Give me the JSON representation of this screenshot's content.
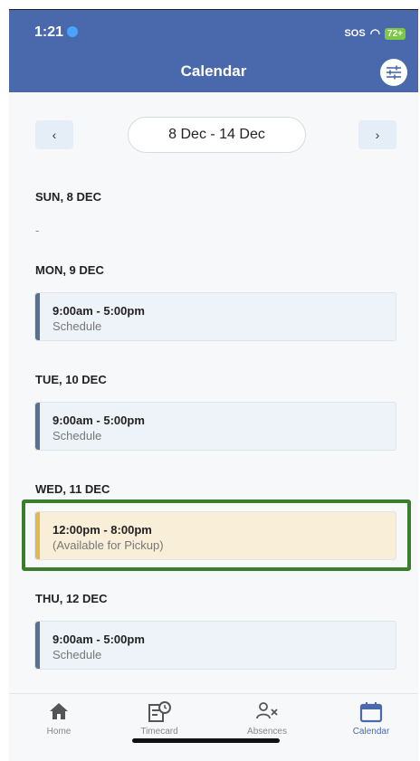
{
  "status_bar": {
    "time": "1:21",
    "sos": "SOS",
    "battery": "72+"
  },
  "header": {
    "title": "Calendar"
  },
  "week": {
    "prev": "‹",
    "range": "8 Dec - 14 Dec",
    "next": "›"
  },
  "days": [
    {
      "label": "SUN, 8 DEC",
      "empty": "-"
    },
    {
      "label": "MON, 9 DEC",
      "time": "9:00am - 5:00pm",
      "sub": "Schedule"
    },
    {
      "label": "TUE, 10 DEC",
      "time": "9:00am - 5:00pm",
      "sub": "Schedule"
    },
    {
      "label": "WED, 11 DEC",
      "time": "12:00pm - 8:00pm",
      "sub": "(Available for Pickup)"
    },
    {
      "label": "THU, 12 DEC",
      "time": "9:00am - 5:00pm",
      "sub": "Schedule"
    }
  ],
  "tabs": [
    {
      "label": "Home",
      "icon": "home-icon"
    },
    {
      "label": "Timecard",
      "icon": "timecard-icon"
    },
    {
      "label": "Absences",
      "icon": "absences-icon"
    },
    {
      "label": "Calendar",
      "icon": "calendar-icon",
      "active": true
    }
  ],
  "colors": {
    "header": "#4a69ad",
    "highlight": "#3a7d2c",
    "pickup_bar": "#e0b94f",
    "schedule_bar": "#5b6f8f"
  }
}
